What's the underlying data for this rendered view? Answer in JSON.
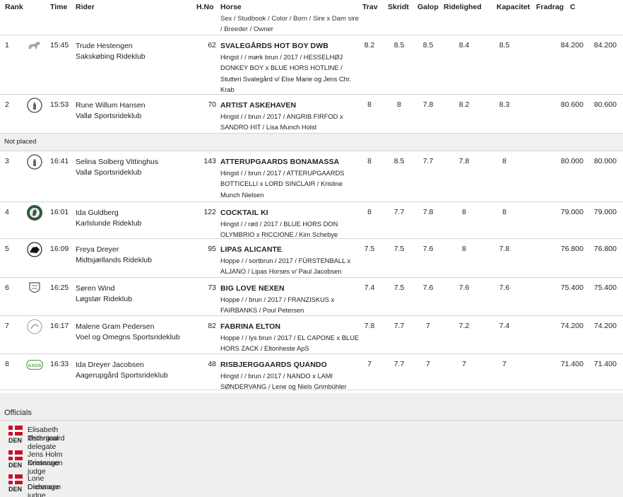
{
  "header": {
    "rank": "Rank",
    "time": "Time",
    "rider": "Rider",
    "hno": "H.No",
    "horse": "Horse",
    "horse_sub": "Sex / Studbook / Color / Born / Sire x Dam sire / Breeder / Owner",
    "scores": [
      "Trav",
      "Skridt",
      "Galop",
      "Ridelighed",
      "Kapacitet",
      "Fradrag"
    ],
    "c": "C"
  },
  "not_placed_label": "Not placed",
  "rows": [
    {
      "rank": "1",
      "logo": "horse-club-logo",
      "time": "15:45",
      "rider": "Trude Hestengen",
      "club": "Sakskøbing Rideklub",
      "hno": "62",
      "horse": "SVALEGÅRDS HOT BOY DWB",
      "details": "Hingst / / mørk brun / 2017 / HESSELHØJ DONKEY BOY x BLUE HORS HOTLINE / Stutteri Svalegård v/ Else Marie og Jens Chr. Krab",
      "scores": [
        "8.2",
        "8.5",
        "8.5",
        "8.4",
        "8.5"
      ],
      "fradrag": "",
      "c": "84.200",
      "total": "84.200"
    },
    {
      "rank": "2",
      "logo": "knight-club-logo",
      "time": "15:53",
      "rider": "Rune Willum Hansen",
      "club": "Vallø Sportsrideklub",
      "hno": "70",
      "horse": "ARTIST ASKEHAVEN",
      "details": "Hingst / / brun / 2017 / ANGRIB FIRFOD x SANDRO HIT / Lisa Munch Holst",
      "scores": [
        "8",
        "8",
        "7.8",
        "8.2",
        "8.3"
      ],
      "fradrag": "",
      "c": "80.600",
      "total": "80.600"
    },
    {
      "rank": "3",
      "logo": "knight-club-logo",
      "time": "16:41",
      "rider": "Selina Solberg Vittinghus",
      "club": "Vallø Sportsrideklub",
      "hno": "143",
      "horse": "ATTERUPGAARDS BONAMASSA",
      "details": "Hingst / / brun / 2017 / ATTERUPGAARDS BOTTICELLI x LORD SINCLAIR / Kristine Munch Nielsen",
      "scores": [
        "8",
        "8.5",
        "7.7",
        "7.8",
        "8"
      ],
      "fradrag": "",
      "c": "80.000",
      "total": "80.000"
    },
    {
      "rank": "4",
      "logo": "green-club-logo",
      "time": "16:01",
      "rider": "Ida Guldberg",
      "club": "Karlslunde Rideklub",
      "hno": "122",
      "horse": "COCKTAIL KI",
      "details": "Hingst / / rød / 2017 / BLUE HORS DON OLYMBRIO x RICCIONE / Kim Schebye",
      "scores": [
        "8",
        "7.7",
        "7.8",
        "8",
        "8"
      ],
      "fradrag": "",
      "c": "79.000",
      "total": "79.000"
    },
    {
      "rank": "5",
      "logo": "rider-club-logo",
      "time": "16:09",
      "rider": "Freya Dreyer",
      "club": "Midtsjællands Rideklub",
      "hno": "95",
      "horse": "LIPAS ALICANTE",
      "details": "Hoppe / / sortbrun / 2017 / FÜRSTENBALL x ALJANO / Lipas Horses v/ Paul Jacobsen",
      "scores": [
        "7.5",
        "7.5",
        "7.6",
        "8",
        "7.8"
      ],
      "fradrag": "",
      "c": "76.800",
      "total": "76.800"
    },
    {
      "rank": "6",
      "logo": "crest-club-logo",
      "time": "16:25",
      "rider": "Søren Wind",
      "club": "Løgstør Rideklub",
      "hno": "73",
      "horse": "BIG LOVE NEXEN",
      "details": "Hoppe / / brun / 2017 / FRANZISKUS x FAIRBANKS / Poul Petersen",
      "scores": [
        "7.4",
        "7.5",
        "7.6",
        "7.6",
        "7.6"
      ],
      "fradrag": "",
      "c": "75.400",
      "total": "75.400"
    },
    {
      "rank": "7",
      "logo": "circle-club-logo",
      "time": "16:17",
      "rider": "Malene Gram Pedersen",
      "club": "Voel og Omegns Sportsrideklub",
      "hno": "82",
      "horse": "FABRINA ELTON",
      "details": "Hoppe / / lys brun / 2017 / EL CAPONE x BLUE HORS ZACK / Eltonheste ApS",
      "scores": [
        "7.8",
        "7.7",
        "7",
        "7.2",
        "7.4"
      ],
      "fradrag": "",
      "c": "74.200",
      "total": "74.200"
    },
    {
      "rank": "8",
      "logo": "aags-club-logo",
      "logo_text": "AAGS",
      "time": "16:33",
      "rider": "Ida Dreyer Jacobsen",
      "club": "Aagerupgård Sportsrideklub",
      "hno": "48",
      "horse": "RISBJERGGAARDS QUANDO",
      "details": "Hingst / / brun / 2017 / NANDO x LAMI SØNDERVANG / Lene og Niels Grimbühler",
      "scores": [
        "7",
        "7.7",
        "7",
        "7",
        "7"
      ],
      "fradrag": "",
      "c": "71.400",
      "total": "71.400"
    }
  ],
  "officials": {
    "title": "Officials",
    "items": [
      {
        "name": "Elisabeth Østergaard",
        "role": "Technical delegate",
        "country": "DEN"
      },
      {
        "name": "Jens Holm Kristensen",
        "role": "Dressage judge",
        "country": "DEN"
      },
      {
        "name": "Lone Dichmann",
        "role": "Dressage judge",
        "country": "DEN"
      }
    ]
  },
  "colors": {
    "flag_red": "#c8102e",
    "border": "#d5d5d5",
    "section_bg": "#efefef"
  }
}
